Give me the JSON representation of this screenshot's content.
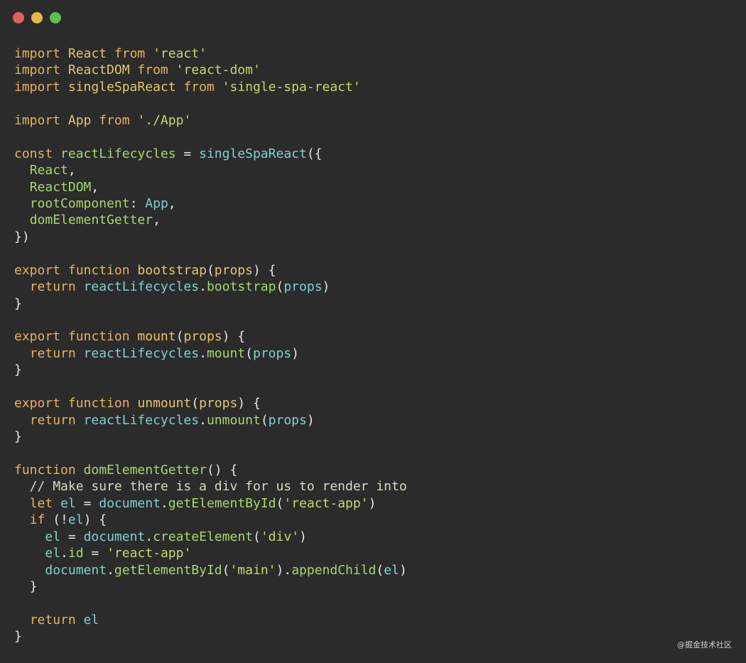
{
  "window": {
    "controls": [
      {
        "name": "close-dot",
        "color": "#e0605a"
      },
      {
        "name": "minimize-dot",
        "color": "#e6b84a"
      },
      {
        "name": "maximize-dot",
        "color": "#5fbf55"
      }
    ]
  },
  "theme": {
    "keyword": "#e9b15a",
    "import_name": "#e9c46a",
    "string": "#c7d66b",
    "property": "#a6d86b",
    "variable": "#7fd1d1",
    "method": "#a6d86b",
    "punct": "#e6e6e6",
    "comment": "#d9d9c0"
  },
  "code_lines": [
    [
      [
        "kw",
        "import "
      ],
      [
        "imp",
        "React "
      ],
      [
        "kw",
        "from "
      ],
      [
        "str",
        "'react'"
      ]
    ],
    [
      [
        "kw",
        "import "
      ],
      [
        "imp",
        "ReactDOM "
      ],
      [
        "kw",
        "from "
      ],
      [
        "str",
        "'react-dom'"
      ]
    ],
    [
      [
        "kw",
        "import "
      ],
      [
        "imp",
        "singleSpaReact "
      ],
      [
        "kw",
        "from "
      ],
      [
        "str",
        "'single-spa-react'"
      ]
    ],
    [],
    [
      [
        "kw",
        "import "
      ],
      [
        "imp",
        "App "
      ],
      [
        "kw",
        "from "
      ],
      [
        "str",
        "'./App'"
      ]
    ],
    [],
    [
      [
        "kw",
        "const "
      ],
      [
        "prop",
        "reactLifecycles"
      ],
      [
        "pun",
        " = "
      ],
      [
        "var",
        "singleSpaReact"
      ],
      [
        "pun",
        "({"
      ]
    ],
    [
      [
        "pun",
        "  "
      ],
      [
        "prop",
        "React"
      ],
      [
        "pun",
        ","
      ]
    ],
    [
      [
        "pun",
        "  "
      ],
      [
        "prop",
        "ReactDOM"
      ],
      [
        "pun",
        ","
      ]
    ],
    [
      [
        "pun",
        "  "
      ],
      [
        "prop",
        "rootComponent"
      ],
      [
        "pun",
        ": "
      ],
      [
        "var",
        "App"
      ],
      [
        "pun",
        ","
      ]
    ],
    [
      [
        "pun",
        "  "
      ],
      [
        "prop",
        "domElementGetter"
      ],
      [
        "pun",
        ","
      ]
    ],
    [
      [
        "pun",
        "})"
      ]
    ],
    [],
    [
      [
        "kw",
        "export "
      ],
      [
        "kw",
        "function "
      ],
      [
        "imp",
        "bootstrap"
      ],
      [
        "pun",
        "("
      ],
      [
        "imp",
        "props"
      ],
      [
        "pun",
        ") {"
      ]
    ],
    [
      [
        "pun",
        "  "
      ],
      [
        "kw",
        "return "
      ],
      [
        "var",
        "reactLifecycles"
      ],
      [
        "pun",
        "."
      ],
      [
        "meth",
        "bootstrap"
      ],
      [
        "pun",
        "("
      ],
      [
        "var",
        "props"
      ],
      [
        "pun",
        ")"
      ]
    ],
    [
      [
        "pun",
        "}"
      ]
    ],
    [],
    [
      [
        "kw",
        "export "
      ],
      [
        "kw",
        "function "
      ],
      [
        "imp",
        "mount"
      ],
      [
        "pun",
        "("
      ],
      [
        "imp",
        "props"
      ],
      [
        "pun",
        ") {"
      ]
    ],
    [
      [
        "pun",
        "  "
      ],
      [
        "kw",
        "return "
      ],
      [
        "var",
        "reactLifecycles"
      ],
      [
        "pun",
        "."
      ],
      [
        "meth",
        "mount"
      ],
      [
        "pun",
        "("
      ],
      [
        "var",
        "props"
      ],
      [
        "pun",
        ")"
      ]
    ],
    [
      [
        "pun",
        "}"
      ]
    ],
    [],
    [
      [
        "kw",
        "export "
      ],
      [
        "kw",
        "function "
      ],
      [
        "imp",
        "unmount"
      ],
      [
        "pun",
        "("
      ],
      [
        "imp",
        "props"
      ],
      [
        "pun",
        ") {"
      ]
    ],
    [
      [
        "pun",
        "  "
      ],
      [
        "kw",
        "return "
      ],
      [
        "var",
        "reactLifecycles"
      ],
      [
        "pun",
        "."
      ],
      [
        "meth",
        "unmount"
      ],
      [
        "pun",
        "("
      ],
      [
        "var",
        "props"
      ],
      [
        "pun",
        ")"
      ]
    ],
    [
      [
        "pun",
        "}"
      ]
    ],
    [],
    [
      [
        "kw",
        "function "
      ],
      [
        "meth",
        "domElementGetter"
      ],
      [
        "pun",
        "() {"
      ]
    ],
    [
      [
        "pun",
        "  "
      ],
      [
        "com",
        "// Make sure there is a div for us to render into"
      ]
    ],
    [
      [
        "pun",
        "  "
      ],
      [
        "kw",
        "let "
      ],
      [
        "var",
        "el"
      ],
      [
        "pun",
        " = "
      ],
      [
        "var",
        "document"
      ],
      [
        "pun",
        "."
      ],
      [
        "meth",
        "getElementById"
      ],
      [
        "pun",
        "("
      ],
      [
        "str",
        "'react-app'"
      ],
      [
        "pun",
        ")"
      ]
    ],
    [
      [
        "pun",
        "  "
      ],
      [
        "kw",
        "if "
      ],
      [
        "pun",
        "(!"
      ],
      [
        "var",
        "el"
      ],
      [
        "pun",
        ") {"
      ]
    ],
    [
      [
        "pun",
        "    "
      ],
      [
        "var",
        "el"
      ],
      [
        "pun",
        " = "
      ],
      [
        "var",
        "document"
      ],
      [
        "pun",
        "."
      ],
      [
        "meth",
        "createElement"
      ],
      [
        "pun",
        "("
      ],
      [
        "str",
        "'div'"
      ],
      [
        "pun",
        ")"
      ]
    ],
    [
      [
        "pun",
        "    "
      ],
      [
        "var",
        "el"
      ],
      [
        "pun",
        "."
      ],
      [
        "prop",
        "id"
      ],
      [
        "pun",
        " = "
      ],
      [
        "str",
        "'react-app'"
      ]
    ],
    [
      [
        "pun",
        "    "
      ],
      [
        "var",
        "document"
      ],
      [
        "pun",
        "."
      ],
      [
        "meth",
        "getElementById"
      ],
      [
        "pun",
        "("
      ],
      [
        "str",
        "'main'"
      ],
      [
        "pun",
        ")."
      ],
      [
        "meth",
        "appendChild"
      ],
      [
        "pun",
        "("
      ],
      [
        "var",
        "el"
      ],
      [
        "pun",
        ")"
      ]
    ],
    [
      [
        "pun",
        "  }"
      ]
    ],
    [],
    [
      [
        "pun",
        "  "
      ],
      [
        "kw",
        "return "
      ],
      [
        "var",
        "el"
      ]
    ],
    [
      [
        "pun",
        "}"
      ]
    ]
  ],
  "watermark": "@掘金技术社区"
}
